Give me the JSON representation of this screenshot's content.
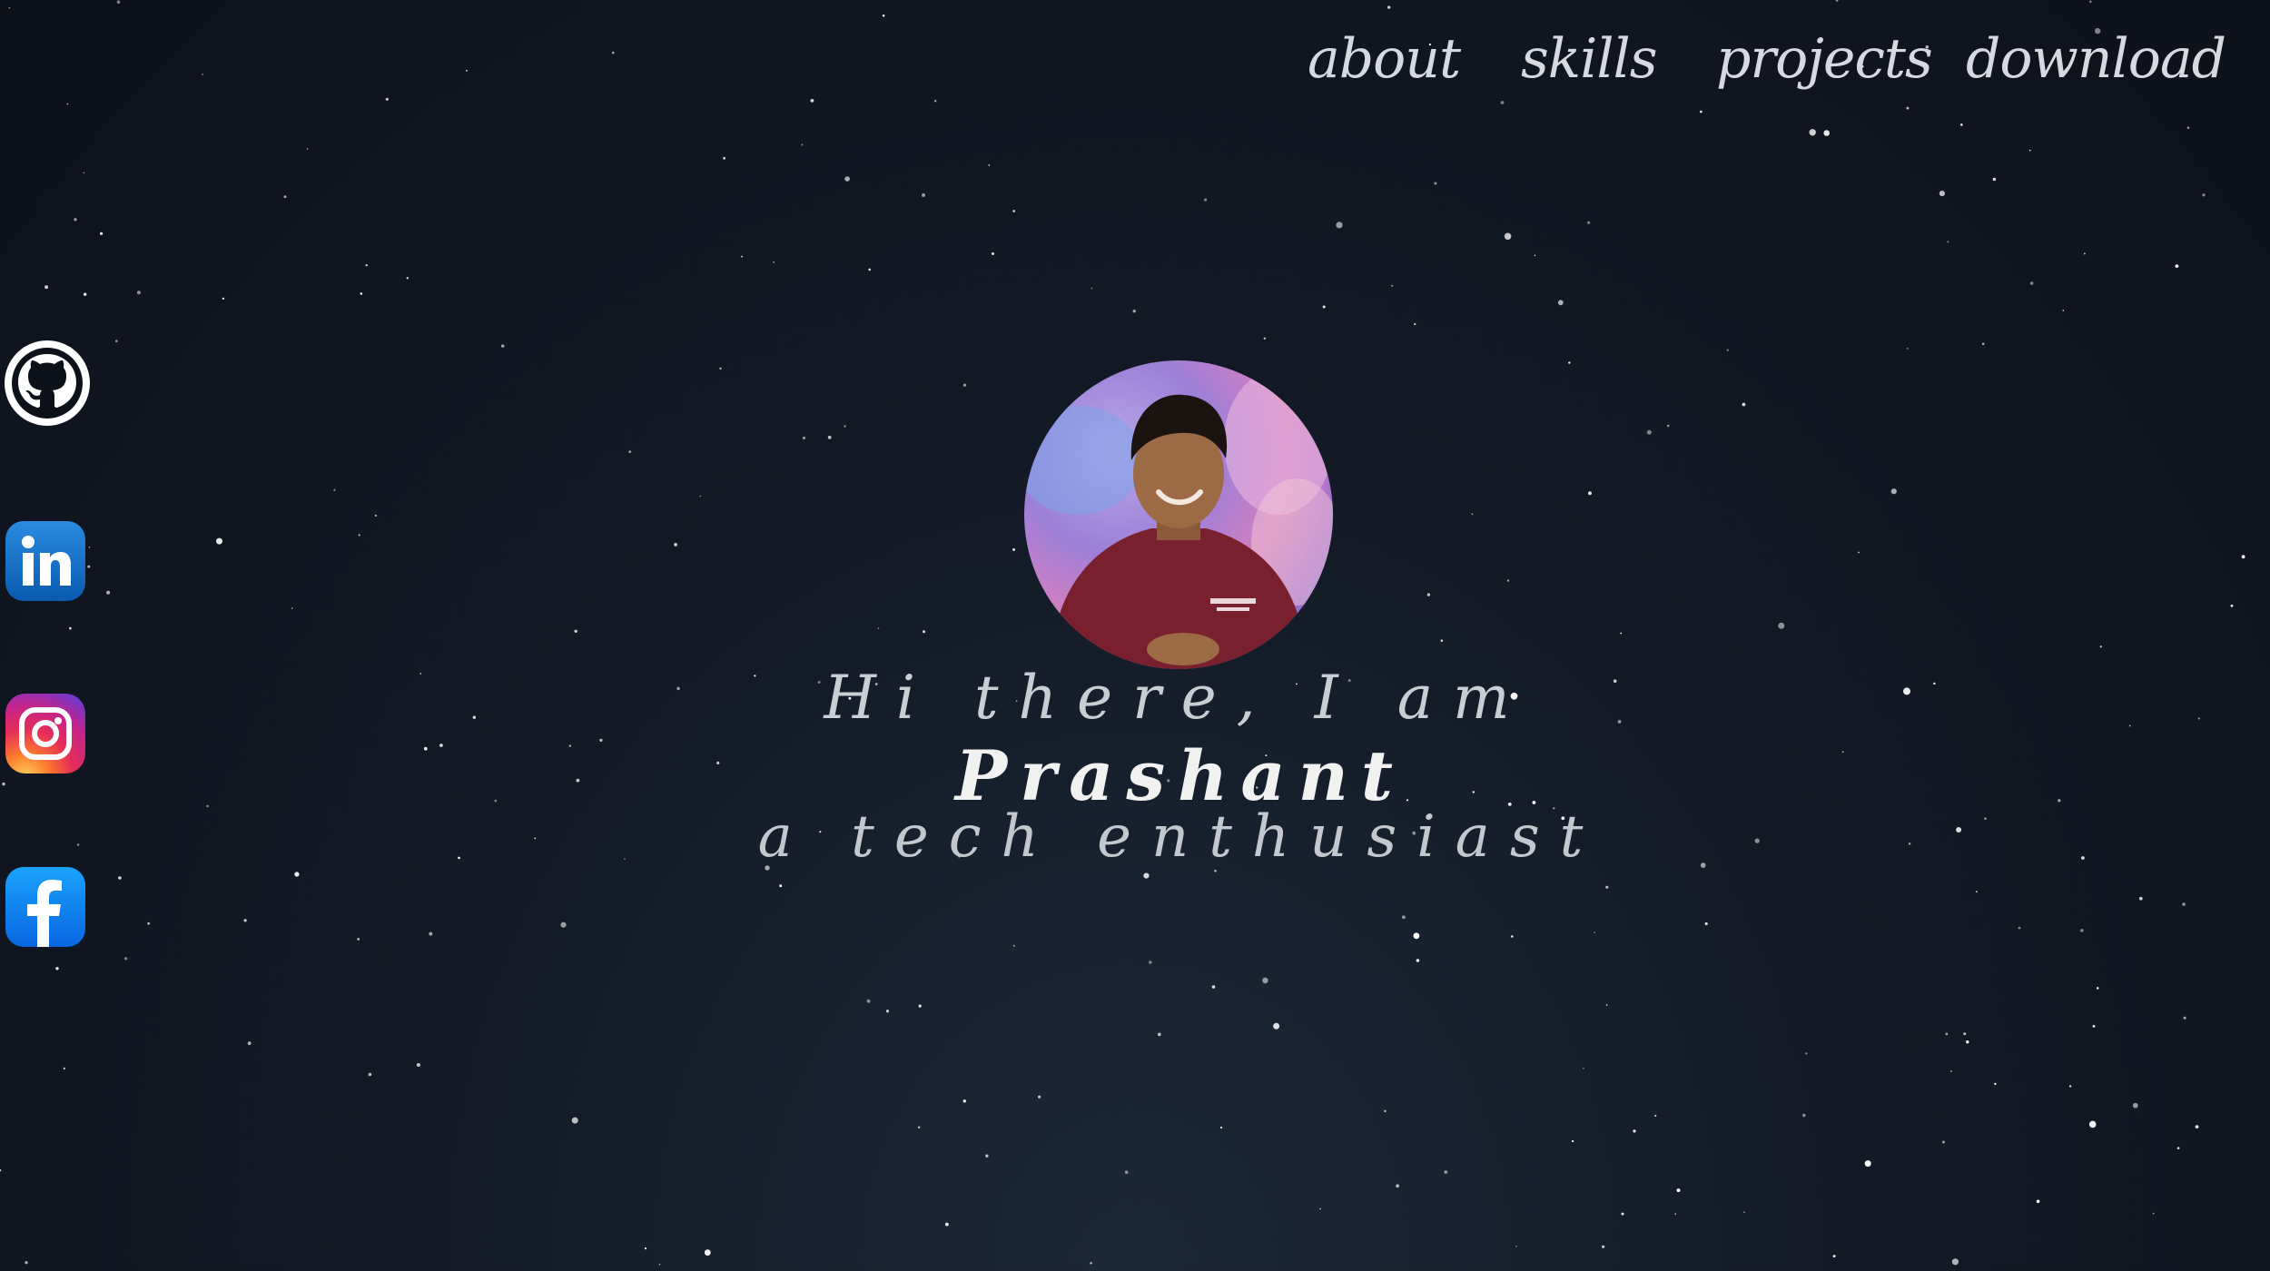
{
  "nav": {
    "about": "about",
    "skills": "skills",
    "projects": "projects",
    "download": "download"
  },
  "social": [
    "github-icon",
    "linkedin-icon",
    "instagram-icon",
    "facebook-icon"
  ],
  "hero": {
    "greeting": "Hi there, I am",
    "name": "Prashant",
    "tagline": "a tech enthusiast"
  },
  "colors": {
    "background": "#131a26",
    "text": "#d6d9e0",
    "linkedin": "#0a66c2",
    "facebook": "#1877f2"
  }
}
